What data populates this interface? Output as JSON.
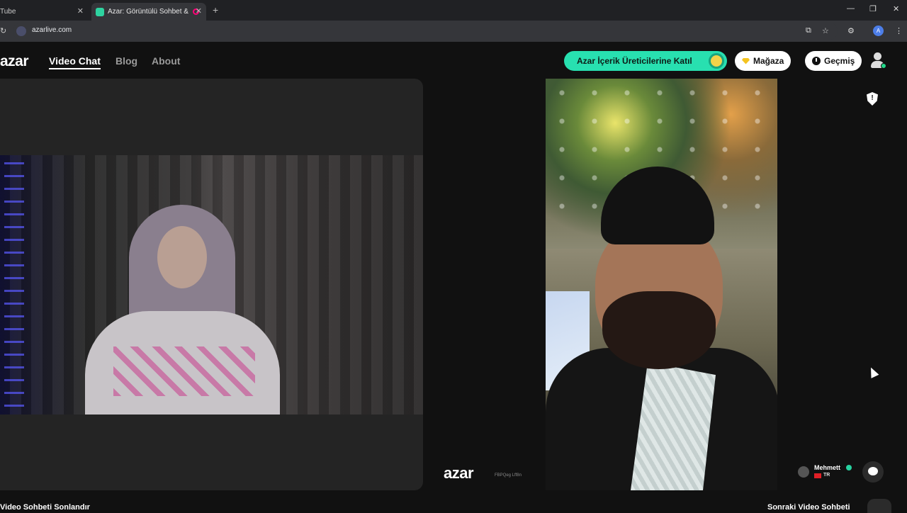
{
  "browser": {
    "tabs": [
      {
        "title": "Tube",
        "active": false
      },
      {
        "title": "Azar: Görüntülü Sohbet & ",
        "active": true
      }
    ],
    "url": "azarlive.com",
    "profile_initial": "A"
  },
  "header": {
    "logo": "azar",
    "nav": [
      {
        "label": "Video Chat",
        "active": true
      },
      {
        "label": "Blog",
        "active": false
      },
      {
        "label": "About",
        "active": false
      }
    ],
    "creator_button": "Azar İçerik Üreticilerine Katıl",
    "shop_button": "Mağaza",
    "history_button": "Geçmiş"
  },
  "video": {
    "watermark": "azar",
    "watermark_id": "FBPQeg Lff8n",
    "peer": {
      "name": "Mehmett",
      "country": "TR"
    }
  },
  "footer": {
    "end_chat": "Video Sohbeti Sonlandır",
    "next_chat": "Sonraki Video Sohbeti"
  },
  "colors": {
    "accent": "#28e0b0",
    "background": "#111111",
    "panel": "#242424"
  },
  "icons": [
    "reload-icon",
    "site-icon",
    "install-icon",
    "star-icon",
    "extensions-icon",
    "menu-icon",
    "gem-icon",
    "clock-icon",
    "profile-icon",
    "shield-icon",
    "chat-icon"
  ]
}
